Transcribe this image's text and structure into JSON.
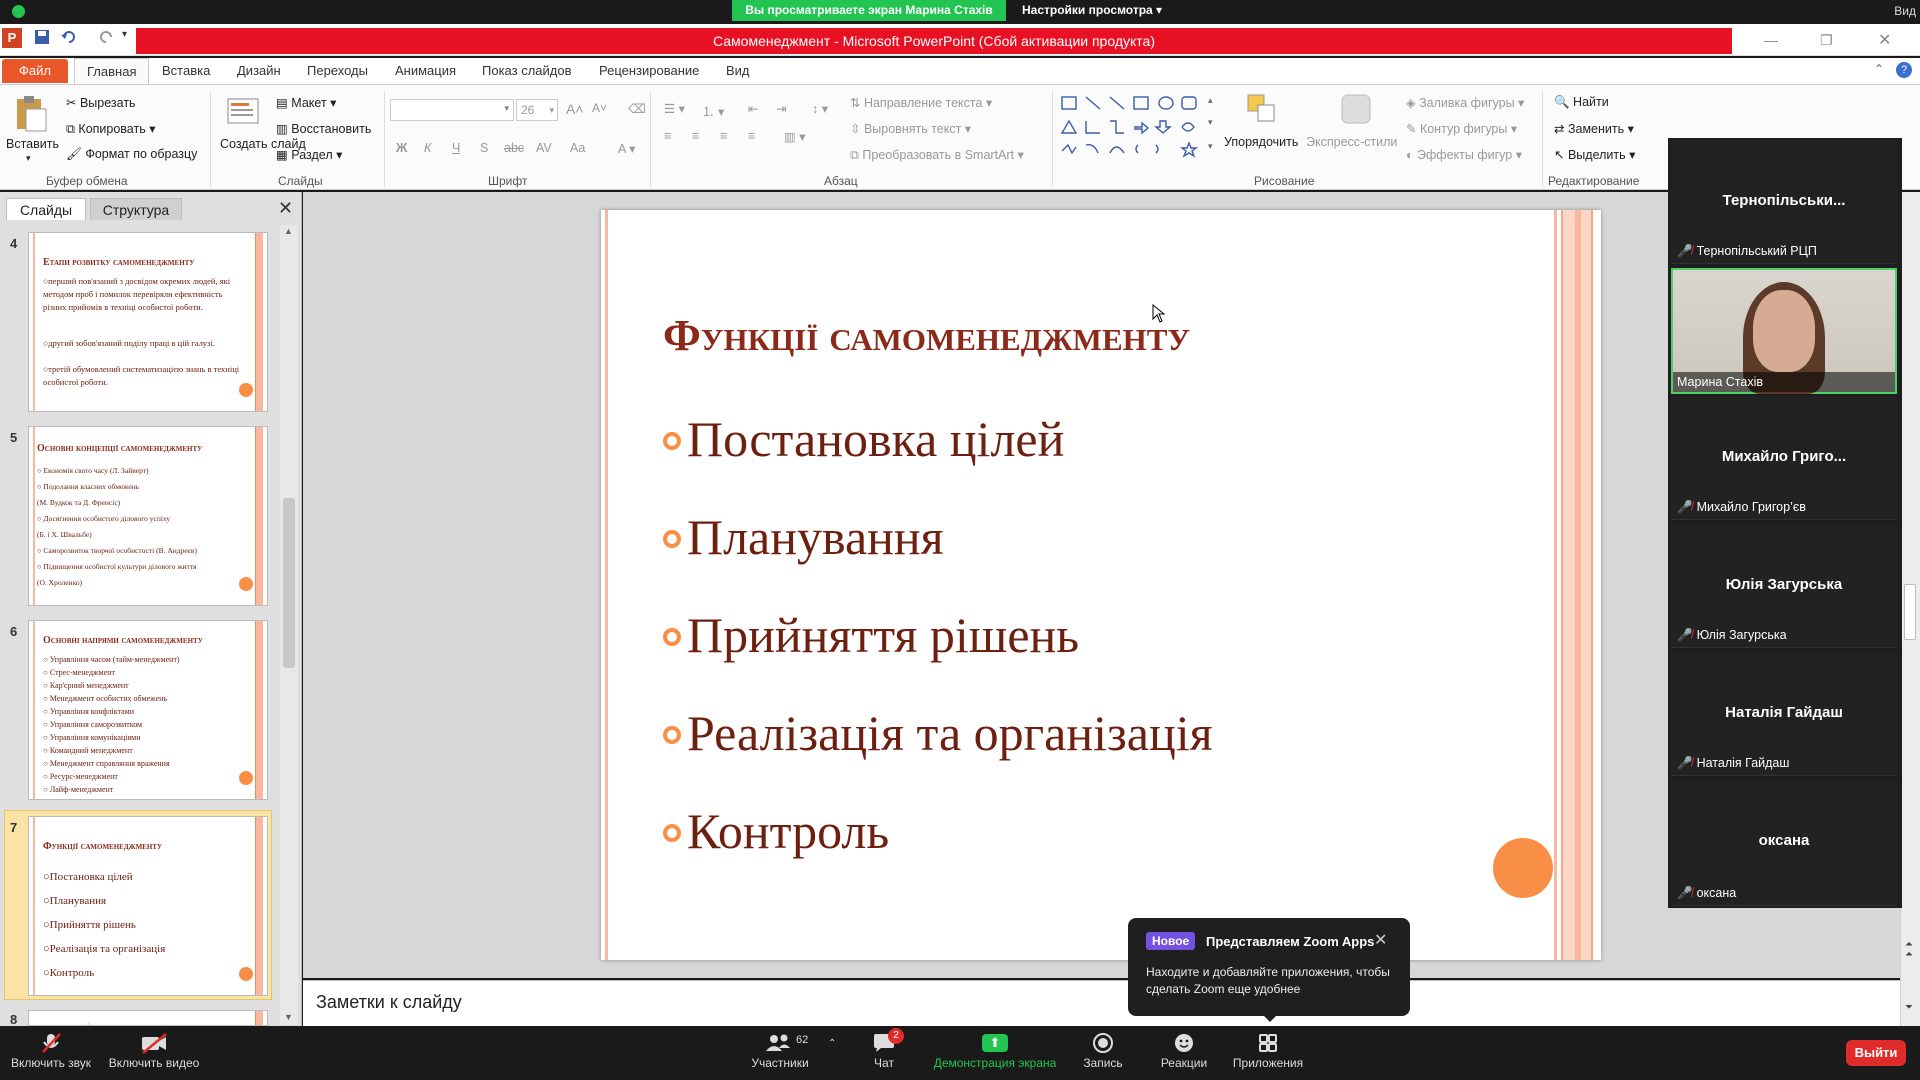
{
  "zoom_top": {
    "share_banner": "Вы просматриваете экран Марина Стахів",
    "view_settings": "Настройки просмотра ▾",
    "view_button": "Вид"
  },
  "window": {
    "title": "Самоменеджмент  -  Microsoft PowerPoint (Сбой активации продукта)"
  },
  "ribbon_tabs": [
    "Файл",
    "Главная",
    "Вставка",
    "Дизайн",
    "Переходы",
    "Анимация",
    "Показ слайдов",
    "Рецензирование",
    "Вид"
  ],
  "ribbon": {
    "clipboard": {
      "paste": "Вставить",
      "cut": "Вырезать",
      "copy": "Копировать",
      "format_painter": "Формат по образцу",
      "label": "Буфер обмена"
    },
    "slides": {
      "new_slide": "Создать слайд",
      "layout": "Макет",
      "reset": "Восстановить",
      "section": "Раздел",
      "label": "Слайды"
    },
    "font": {
      "font_size": "26",
      "label": "Шрифт"
    },
    "paragraph": {
      "text_direction": "Направление текста",
      "align_text": "Выровнять текст",
      "smartart": "Преобразовать в SmartArt",
      "label": "Абзац"
    },
    "drawing": {
      "arrange": "Упорядочить",
      "quick_styles": "Экспресс-стили",
      "shape_fill": "Заливка фигуры",
      "shape_outline": "Контур фигуры",
      "shape_effects": "Эффекты фигур",
      "label": "Рисование"
    },
    "editing": {
      "find": "Найти",
      "replace": "Заменить",
      "select": "Выделить",
      "label": "Редактирование"
    }
  },
  "left_panel": {
    "tab_slides": "Слайды",
    "tab_outline": "Структура",
    "slides": [
      {
        "number": "4",
        "title": "Етапи розвитку самоменеджменту",
        "lines": [
          "○перший пов'язаний з досвідом окремих людей, які методом проб і помилок перевіряли ефективність різних прийомів в техніці особистої роботи.",
          "○другий зобов'язаний поділу праці в цій галузі.",
          "○третій обумовлений систематизацією знань в техніці особистої роботи."
        ]
      },
      {
        "number": "5",
        "title": "Основні концепції самоменеджменту",
        "lines": [
          "○ Економія свого часу (Л. Зайверт)",
          "○ Подолання власних обмежень",
          "(М. Вудкок та Д. Френсіс)",
          "○ Досягнення особистого ділового успіху",
          "(Б. і Х. Швальбе)",
          "○ Саморозвиток творчої особистості (В. Андреєв)",
          "○ Підвищення особистої культури ділового життя",
          "(О. Хроленко)"
        ]
      },
      {
        "number": "6",
        "title": "Основні напрями самоменеджменту",
        "lines": [
          "○ Управління часом (тайм-менеджмент)",
          "○ Стрес-менеджмент",
          "○ Кар'єрний менеджмент",
          "○ Менеджмент особистих обмежень",
          "○ Управління конфліктами",
          "○ Управління саморозвитком",
          "○ Управління комунікаціями",
          "○ Командний менеджмент",
          "○ Менеджмент справляння враження",
          "○ Ресурс-менеджмент",
          "○ Лайф-менеджмент"
        ]
      },
      {
        "number": "7",
        "title": "Функції самоменеджменту",
        "lines": [
          "○Постановка цілей",
          "○Планування",
          "○Прийняття рішень",
          "○Реалізація та організація",
          "○Контроль"
        ]
      },
      {
        "number": "8"
      }
    ]
  },
  "slide": {
    "title": "Функції самоменеджменту",
    "bullets": [
      "Постановка цілей",
      "Планування",
      "Прийняття рішень",
      "Реалізація та організація",
      "Контроль"
    ]
  },
  "notes": {
    "placeholder": "Заметки к слайду"
  },
  "participants": [
    {
      "name": "Тернопільськи...",
      "label": "Тернопільський РЦП"
    },
    {
      "name": "Марина Стахів",
      "label": "Марина Стахів",
      "video": true
    },
    {
      "name": "Михайло  Григо...",
      "label": "Михайло Григор’єв"
    },
    {
      "name": "Юлія Загурська",
      "label": "Юлія Загурська"
    },
    {
      "name": "Наталія Гайдаш",
      "label": "Наталія Гайдаш"
    },
    {
      "name": "оксана",
      "label": "оксана"
    }
  ],
  "popup": {
    "badge": "Новое",
    "title": "Представляем Zoom Apps",
    "text": "Находите и добавляйте приложения, чтобы сделать Zoom еще удобнее"
  },
  "zoom_bottom": {
    "mute": "Включить звук",
    "video": "Включить видео",
    "participants": "Участники",
    "participants_count": "62",
    "chat": "Чат",
    "chat_badge": "2",
    "share": "Демонстрация экрана",
    "record": "Запись",
    "reactions": "Реакции",
    "apps": "Приложения",
    "leave": "Выйти"
  }
}
